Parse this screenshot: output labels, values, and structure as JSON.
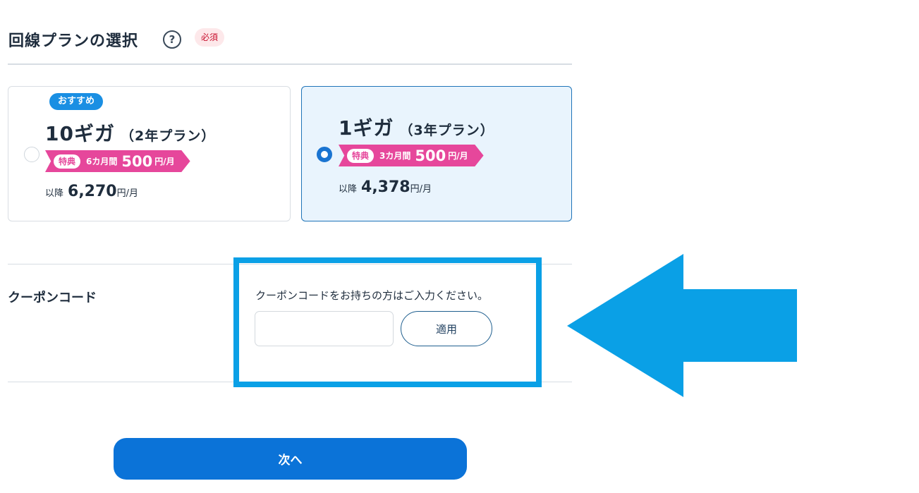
{
  "section": {
    "title": "回線プランの選択",
    "help_icon_glyph": "?",
    "required_label": "必須"
  },
  "plans": [
    {
      "recommend_label": "おすすめ",
      "name": "10ギガ",
      "term": "（2年プラン）",
      "selected": false,
      "promo": {
        "badge": "特典",
        "period": "6カ月間",
        "price": "500",
        "unit": "円/月"
      },
      "after": {
        "label": "以降",
        "price": "6,270",
        "unit": "円/月"
      }
    },
    {
      "name": "1ギガ",
      "term": "（3年プラン）",
      "selected": true,
      "promo": {
        "badge": "特典",
        "period": "3カ月間",
        "price": "500",
        "unit": "円/月"
      },
      "after": {
        "label": "以降",
        "price": "4,378",
        "unit": "円/月"
      }
    }
  ],
  "coupon": {
    "label": "クーポンコード",
    "instruction": "クーポンコードをお持ちの方はご入力ください。",
    "input_value": "",
    "apply_label": "適用"
  },
  "next_label": "次へ",
  "colors": {
    "primary": "#0b73d8",
    "promo_pink": "#e6479b",
    "highlight": "#0aa0e6",
    "selected_bg": "#e9f4fd"
  }
}
